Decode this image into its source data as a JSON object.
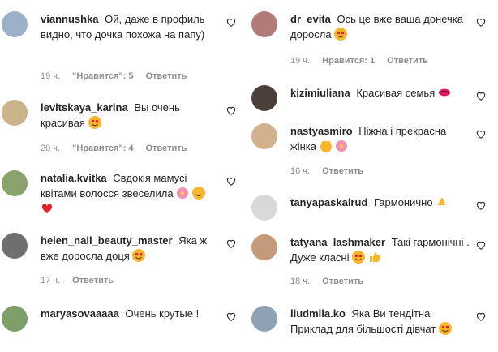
{
  "left": [
    {
      "user": "viannushka",
      "text": "Ой, даже в профиль видно, что дочка похожа на папу)",
      "time": "19 ч.",
      "likes": "\"Нравится\": 5",
      "reply": "Ответить",
      "avatar": "#9bb1c9"
    },
    {
      "user": "levitskaya_karina",
      "text": "Вы очень красивая",
      "time": "20 ч.",
      "likes": "\"Нравится\": 4",
      "reply": "Ответить",
      "avatar": "#c9b48c"
    },
    {
      "user": "natalia.kvitka",
      "text": "Євдокія мамусі квітами волосся звеселила",
      "time": "",
      "likes": "",
      "reply": "",
      "avatar": "#8aa36c"
    },
    {
      "user": "helen_nail_beauty_master",
      "text": "Яка ж вже доросла доця",
      "time": "17 ч.",
      "likes": "",
      "reply": "Ответить",
      "avatar": "#6f6f6f"
    },
    {
      "user": "maryasovaaaaa",
      "text": "Очень крутые !",
      "time": "",
      "likes": "",
      "reply": "",
      "avatar": "#7f9f6a"
    }
  ],
  "right": [
    {
      "user": "dr_evita",
      "text": "Ось це вже ваша донечка доросла",
      "time": "19 ч.",
      "likes": "Нравится: 1",
      "reply": "Ответить",
      "avatar": "#b07b79"
    },
    {
      "user": "kizimiuliana",
      "text": "Красивая семья",
      "time": "",
      "likes": "",
      "reply": "",
      "avatar": "#4b3f3a"
    },
    {
      "user": "nastyasmiro",
      "text": "Ніжна і прекрасна жінка",
      "time": "16 ч.",
      "likes": "",
      "reply": "Ответить",
      "avatar": "#d2b28c"
    },
    {
      "user": "tanyapaskalrud",
      "text": "Гармонично",
      "time": "",
      "likes": "",
      "reply": "",
      "avatar": "#d9d9d9"
    },
    {
      "user": "tatyana_lashmaker",
      "text": "Такі гармонічні . Дуже класні",
      "time": "18 ч.",
      "likes": "",
      "reply": "Ответить",
      "avatar": "#c49a7b"
    },
    {
      "user": "liudmila.ko",
      "text": "Яка Ви тендітна Приклад для більшості дівчат",
      "time": "",
      "likes": "",
      "reply": "",
      "avatar": "#8fa2b4"
    }
  ]
}
